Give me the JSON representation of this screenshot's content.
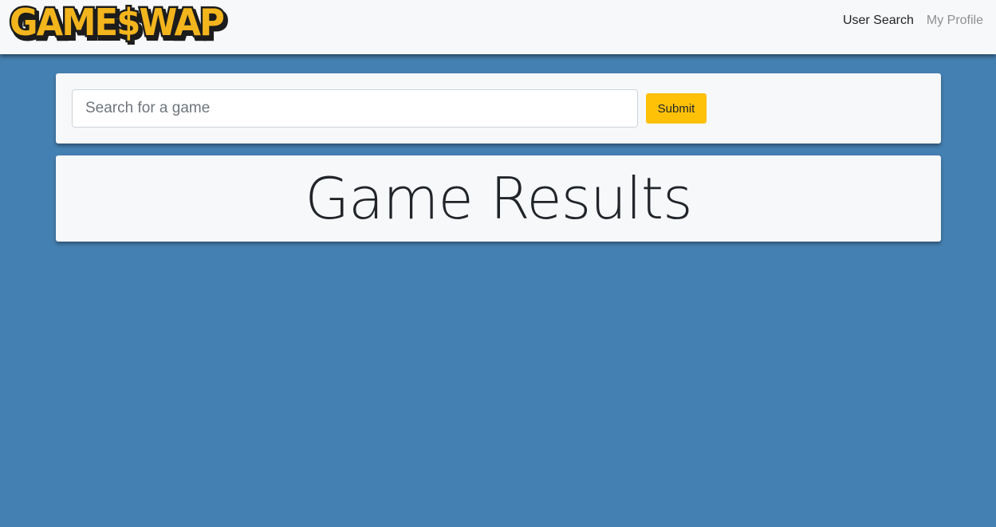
{
  "brand": {
    "logo_text": "GAMESWAP",
    "colors": {
      "fill": "#f3b51d",
      "outline": "#1c1c1c"
    }
  },
  "nav": {
    "items": [
      {
        "label": "User Search",
        "color": "#222222"
      },
      {
        "label": "My Profile",
        "color": "#8f8f8f"
      }
    ]
  },
  "search": {
    "placeholder": "Search for a game",
    "value": "",
    "submit_label": "Submit"
  },
  "results": {
    "title": "Game Results"
  },
  "colors": {
    "background": "#4580b2",
    "card": "#f7f8fa",
    "accent": "#ffc107"
  }
}
